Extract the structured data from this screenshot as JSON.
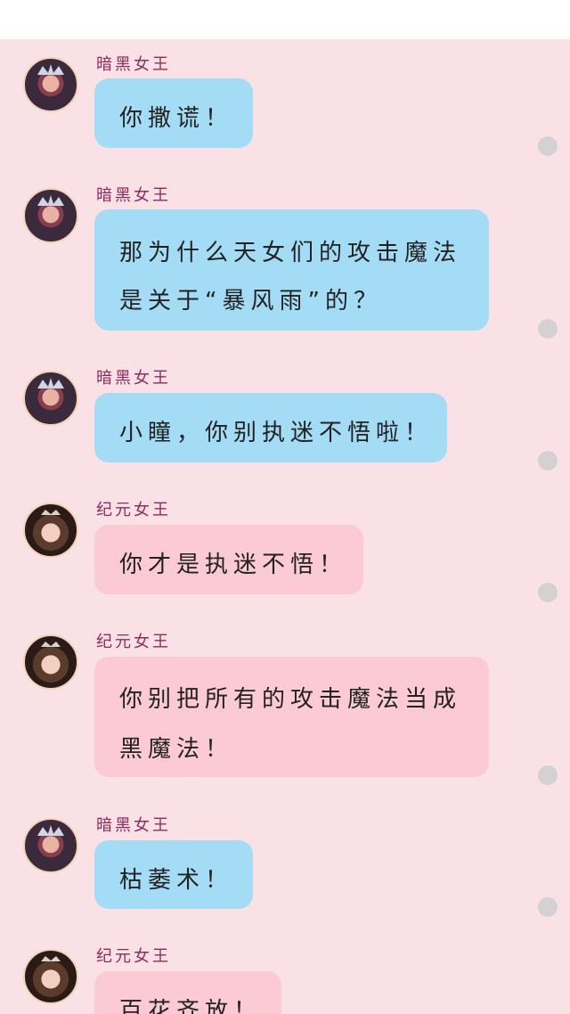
{
  "app": {
    "bubble_colors": {
      "dark_queen": "#a4dcf6",
      "yuan_queen": "#fbcad4"
    },
    "background": "#f9e1e6"
  },
  "messages": [
    {
      "sender": "暗黑女王",
      "avatar_icon": "dark-queen-avatar",
      "lines": [
        "你撒谎！"
      ]
    },
    {
      "sender": "暗黑女王",
      "avatar_icon": "dark-queen-avatar",
      "lines": [
        "那为什么天女们的攻击魔法",
        "是关于“暴风雨”的？"
      ]
    },
    {
      "sender": "暗黑女王",
      "avatar_icon": "dark-queen-avatar",
      "lines": [
        "小瞳，你别执迷不悟啦！"
      ]
    },
    {
      "sender": "纪元女王",
      "avatar_icon": "yuan-queen-avatar",
      "lines": [
        "你才是执迷不悟！"
      ]
    },
    {
      "sender": "纪元女王",
      "avatar_icon": "yuan-queen-avatar",
      "lines": [
        "你别把所有的攻击魔法当成",
        "黑魔法！"
      ]
    },
    {
      "sender": "暗黑女王",
      "avatar_icon": "dark-queen-avatar",
      "lines": [
        "枯萎术！"
      ]
    },
    {
      "sender": "纪元女王",
      "avatar_icon": "yuan-queen-avatar",
      "lines": [
        "百花齐放！"
      ]
    }
  ]
}
